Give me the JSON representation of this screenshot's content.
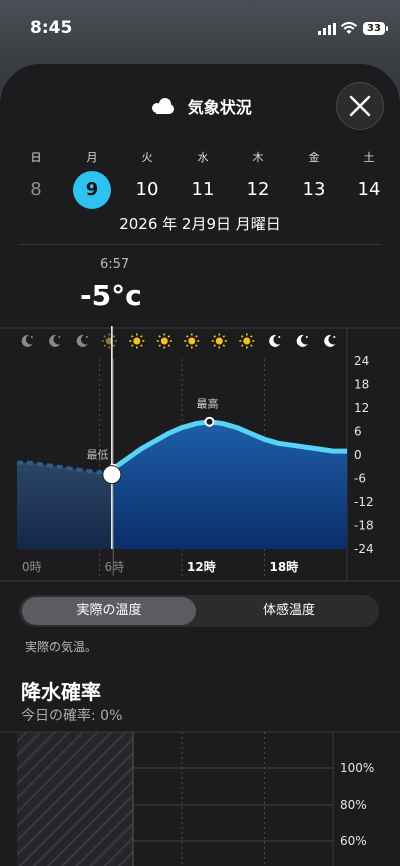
{
  "status_bar": {
    "time": "8:45",
    "battery": "33"
  },
  "header": {
    "title": "気象状況",
    "icon": "cloud-icon",
    "close_icon": "close-icon"
  },
  "days": [
    {
      "dow": "日",
      "num": "8",
      "state": "past"
    },
    {
      "dow": "月",
      "num": "9",
      "state": "selected"
    },
    {
      "dow": "火",
      "num": "10",
      "state": "normal"
    },
    {
      "dow": "水",
      "num": "11",
      "state": "normal"
    },
    {
      "dow": "木",
      "num": "12",
      "state": "normal"
    },
    {
      "dow": "金",
      "num": "13",
      "state": "normal"
    },
    {
      "dow": "土",
      "num": "14",
      "state": "normal"
    }
  ],
  "date_line": "2026 年 2月9日 月曜日",
  "current": {
    "time": "6:57",
    "temp": "-5°c"
  },
  "chart_data": {
    "type": "area",
    "y_ticks": [
      "24",
      "18",
      "12",
      "6",
      "0",
      "-6",
      "-12",
      "-18",
      "-24"
    ],
    "ylim": [
      -24,
      24
    ],
    "x_ticks": [
      "0時",
      "6時",
      "12時",
      "18時"
    ],
    "hours": [
      0,
      1,
      2,
      3,
      4,
      5,
      6,
      7,
      8,
      9,
      10,
      11,
      12,
      13,
      14,
      15,
      16,
      17,
      18,
      19,
      20,
      21,
      22,
      23,
      24
    ],
    "temps": [
      -2,
      -2,
      -2.5,
      -3,
      -3.5,
      -4,
      -4.5,
      -3.5,
      -1,
      1.5,
      3.5,
      5.5,
      7,
      8,
      8.5,
      8,
      7,
      5.5,
      4,
      3,
      2.5,
      2,
      1.5,
      1,
      1
    ],
    "current_hour": 7,
    "min_label": "最低",
    "max_label": "最高",
    "min_hour": 6,
    "max_hour": 14,
    "icons": [
      "moon-icon",
      "moon-icon",
      "moon-icon",
      "sunrise-icon",
      "sun-icon",
      "sun-icon",
      "sun-icon",
      "sun-icon",
      "sun-icon",
      "moon-icon",
      "moon-icon",
      "moon-icon"
    ],
    "colors": {
      "line": "#56d4f5",
      "fill_top": "#1d5fa8",
      "fill_bottom": "#0b2d6b",
      "sun": "#f7c21b"
    }
  },
  "toggle": {
    "active": "実際の温度",
    "inactive": "体感温度"
  },
  "description": "実際の気温。",
  "precip": {
    "title": "降水確率",
    "subtitle": "今日の確率: 0%",
    "y_ticks": [
      "100%",
      "80%",
      "60%"
    ]
  }
}
